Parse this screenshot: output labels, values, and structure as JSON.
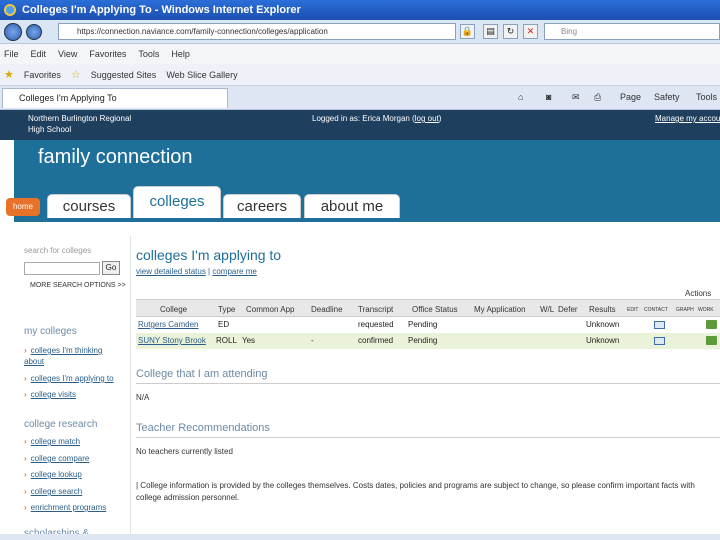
{
  "window": {
    "title": "Colleges I'm Applying To - Windows Internet Explorer"
  },
  "address": {
    "url": "https://connection.naviance.com/family-connection/colleges/application",
    "search_placeholder": "Bing"
  },
  "menu": [
    "File",
    "Edit",
    "View",
    "Favorites",
    "Tools",
    "Help"
  ],
  "favorites": {
    "label": "Favorites",
    "items": [
      "Suggested Sites",
      "Web Slice Gallery"
    ]
  },
  "tab": {
    "label": "Colleges I'm Applying To"
  },
  "commands": {
    "page": "Page",
    "safety": "Safety",
    "tools": "Tools"
  },
  "header": {
    "school": "Northern Burlington Regional High School",
    "school_line1": "Northern Burlington Regional",
    "school_line2": "High School",
    "logged_in_prefix": "Logged in as: Erica Morgan (",
    "logout": "log out",
    "logged_in_suffix": ")",
    "manage": "Manage my account"
  },
  "brand": "family connection",
  "nav": {
    "home": "home",
    "tabs": [
      "courses",
      "colleges",
      "careers",
      "about me"
    ]
  },
  "sidebar": {
    "search_label": "search for colleges",
    "go": "Go",
    "more_options": "MORE SEARCH OPTIONS >>",
    "my_colleges": {
      "heading": "my colleges",
      "items": [
        "colleges I'm thinking about",
        "colleges I'm applying to",
        "college visits"
      ]
    },
    "research": {
      "heading": "college research",
      "items": [
        "college match",
        "college compare",
        "college lookup",
        "college search",
        "enrichment programs"
      ]
    },
    "scholarships": "scholarships &"
  },
  "main": {
    "title": "colleges I'm applying to",
    "view_status": "view detailed status",
    "compare": "compare me",
    "actions": "Actions",
    "columns": [
      "College",
      "Type",
      "Common App",
      "Deadline",
      "Transcript",
      "Office Status",
      "My Application",
      "W/L",
      "Defer",
      "Results"
    ],
    "action_cols": [
      "EDIT",
      "CONTACT",
      "GRAPH",
      "WORK"
    ],
    "rows": [
      {
        "college": "Rutgers Camden",
        "type": "ED",
        "common_app": "",
        "deadline": "",
        "transcript": "requested",
        "office_status": "Pending",
        "results": "Unknown"
      },
      {
        "college": "SUNY Stony Brook",
        "type": "ROLL",
        "common_app": "Yes",
        "deadline": "-",
        "transcript": "confirmed",
        "office_status": "Pending",
        "results": "Unknown"
      }
    ],
    "attending_title": "College that I am attending",
    "attending_value": "N/A",
    "recs_title": "Teacher Recommendations",
    "recs_value": "No teachers currently listed",
    "notice": "| College information is provided by the colleges themselves. Costs dates, policies and programs are subject to change, so please confirm important facts with college admission personnel."
  }
}
